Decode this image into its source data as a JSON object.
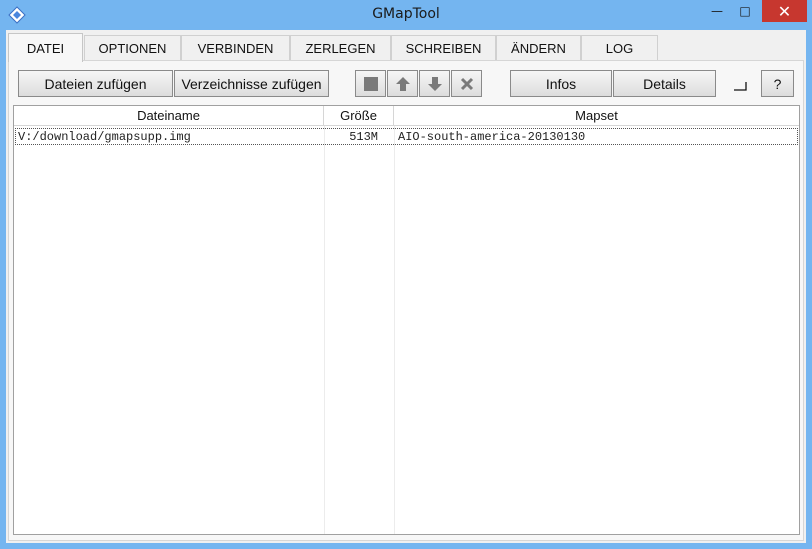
{
  "window": {
    "title": "GMapTool",
    "controls": {
      "minimize": "—",
      "maximize": "□",
      "close": "✕"
    }
  },
  "tabs": [
    {
      "label": "DATEI",
      "active": true
    },
    {
      "label": "OPTIONEN",
      "active": false
    },
    {
      "label": "VERBINDEN",
      "active": false
    },
    {
      "label": "ZERLEGEN",
      "active": false
    },
    {
      "label": "SCHREIBEN",
      "active": false
    },
    {
      "label": "ÄNDERN",
      "active": false
    },
    {
      "label": "LOG",
      "active": false
    }
  ],
  "toolbar": {
    "add_files": "Dateien zufügen",
    "add_directories": "Verzeichnisse zufügen",
    "icon_buttons": [
      "stop-square-icon",
      "arrow-up-icon",
      "arrow-down-icon",
      "delete-x-icon"
    ],
    "info": "Infos",
    "details": "Details",
    "help": "?"
  },
  "table": {
    "columns": [
      "Dateiname",
      "Größe",
      "Mapset"
    ],
    "rows": [
      {
        "filename": "V:/download/gmapsupp.img",
        "size": "513M",
        "mapset": "AIO-south-america-20130130"
      }
    ]
  }
}
